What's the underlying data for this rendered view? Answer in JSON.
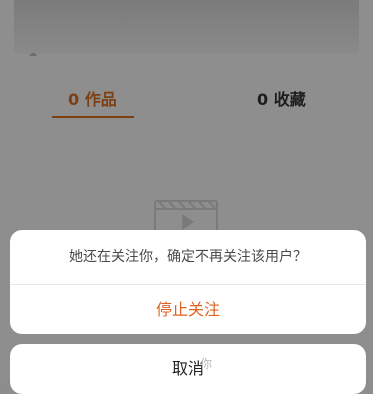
{
  "tabs": {
    "works": "0 作品",
    "favorites": "0 收藏"
  },
  "dialog": {
    "message": "她还在关注你，确定不再关注该用户？",
    "confirm_label": "停止关注",
    "cancel_label": "取消"
  },
  "watermark": "你",
  "banner_speck": "☁",
  "icons": {
    "empty_state": "video-icon"
  },
  "colors": {
    "accent": "#e0621f",
    "tab_active": "#7e3f13",
    "overlay": "#8e8e8e"
  }
}
